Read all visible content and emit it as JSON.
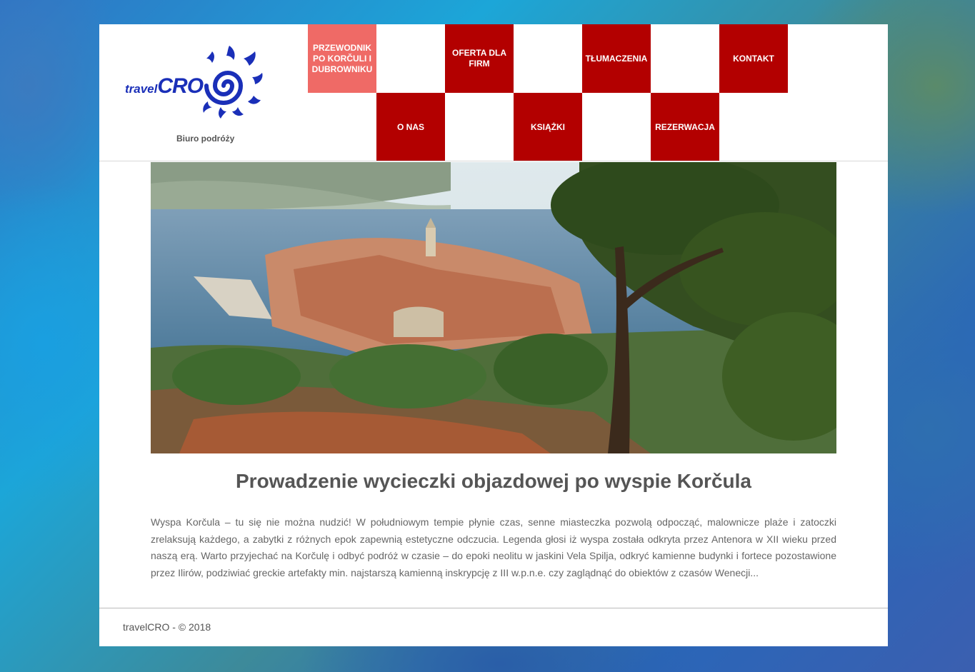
{
  "header": {
    "logo": {
      "small": "travel",
      "big": "CRO"
    },
    "tagline": "Biuro podróży"
  },
  "nav": {
    "przewodnik": "PRZEWODNIK PO KORČULI I DUBROWNIKU",
    "oferta": "OFERTA DLA FIRM",
    "tlumaczenia": "TŁUMACZENIA",
    "kontakt": "KONTAKT",
    "onas": "O NAS",
    "ksiazki": "KSIĄŻKI",
    "rezerwacja": "REZERWACJA"
  },
  "colors": {
    "nav_red": "#b30000",
    "nav_active": "#ef6a66",
    "logo_blue": "#1a2fb8"
  },
  "main": {
    "title": "Prowadzenie wycieczki objazdowej po wyspie Korčula",
    "body": "Wyspa Korčula – tu się nie można nudzić! W południowym tempie płynie czas, senne miasteczka pozwolą odpocząć, malownicze plaże i zatoczki zrelaksują każdego, a zabytki z różnych epok zapewnią estetyczne odczucia. Legenda głosi iż wyspa została odkryta przez Antenora w XII wieku przed naszą erą. Warto przyjechać na Korčulę i odbyć podróż w czasie – do epoki neolitu w jaskini Vela Spilja, odkryć kamienne budynki i fortece pozostawione przez Ilirów, podziwiać greckie artefakty min. najstarszą kamienną inskrypcję z III w.p.n.e. czy zaglądnąć do obiektów z czasów Wenecji..."
  },
  "footer": {
    "text": "travelCRO - © 2018"
  }
}
